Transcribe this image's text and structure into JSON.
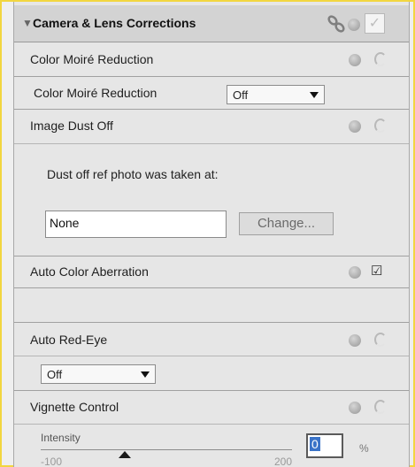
{
  "header": {
    "title": "Camera & Lens Corrections",
    "icons": [
      "collapse-arrow-icon",
      "link-icon",
      "help-icon",
      "checkbox-icon"
    ]
  },
  "color_moire": {
    "title": "Color Moiré Reduction",
    "control_label": "Color Moiré Reduction",
    "selected": "Off"
  },
  "dust_off": {
    "title": "Image Dust Off",
    "prompt": "Dust off ref photo was taken at:",
    "value": "None",
    "button": "Change..."
  },
  "auto_color_aberration": {
    "title": "Auto Color Aberration",
    "checked": true
  },
  "red_eye": {
    "title": "Auto Red-Eye",
    "selected": "Off"
  },
  "vignette": {
    "title": "Vignette Control",
    "slider_label": "Intensity",
    "min": "-100",
    "max": "200",
    "value": "0",
    "unit": "%",
    "value_fraction": 0.333
  },
  "colors": {
    "outer_border": "#f2d640",
    "panel_bg": "#e6e6e6",
    "header_bg": "#d3d3d3"
  }
}
